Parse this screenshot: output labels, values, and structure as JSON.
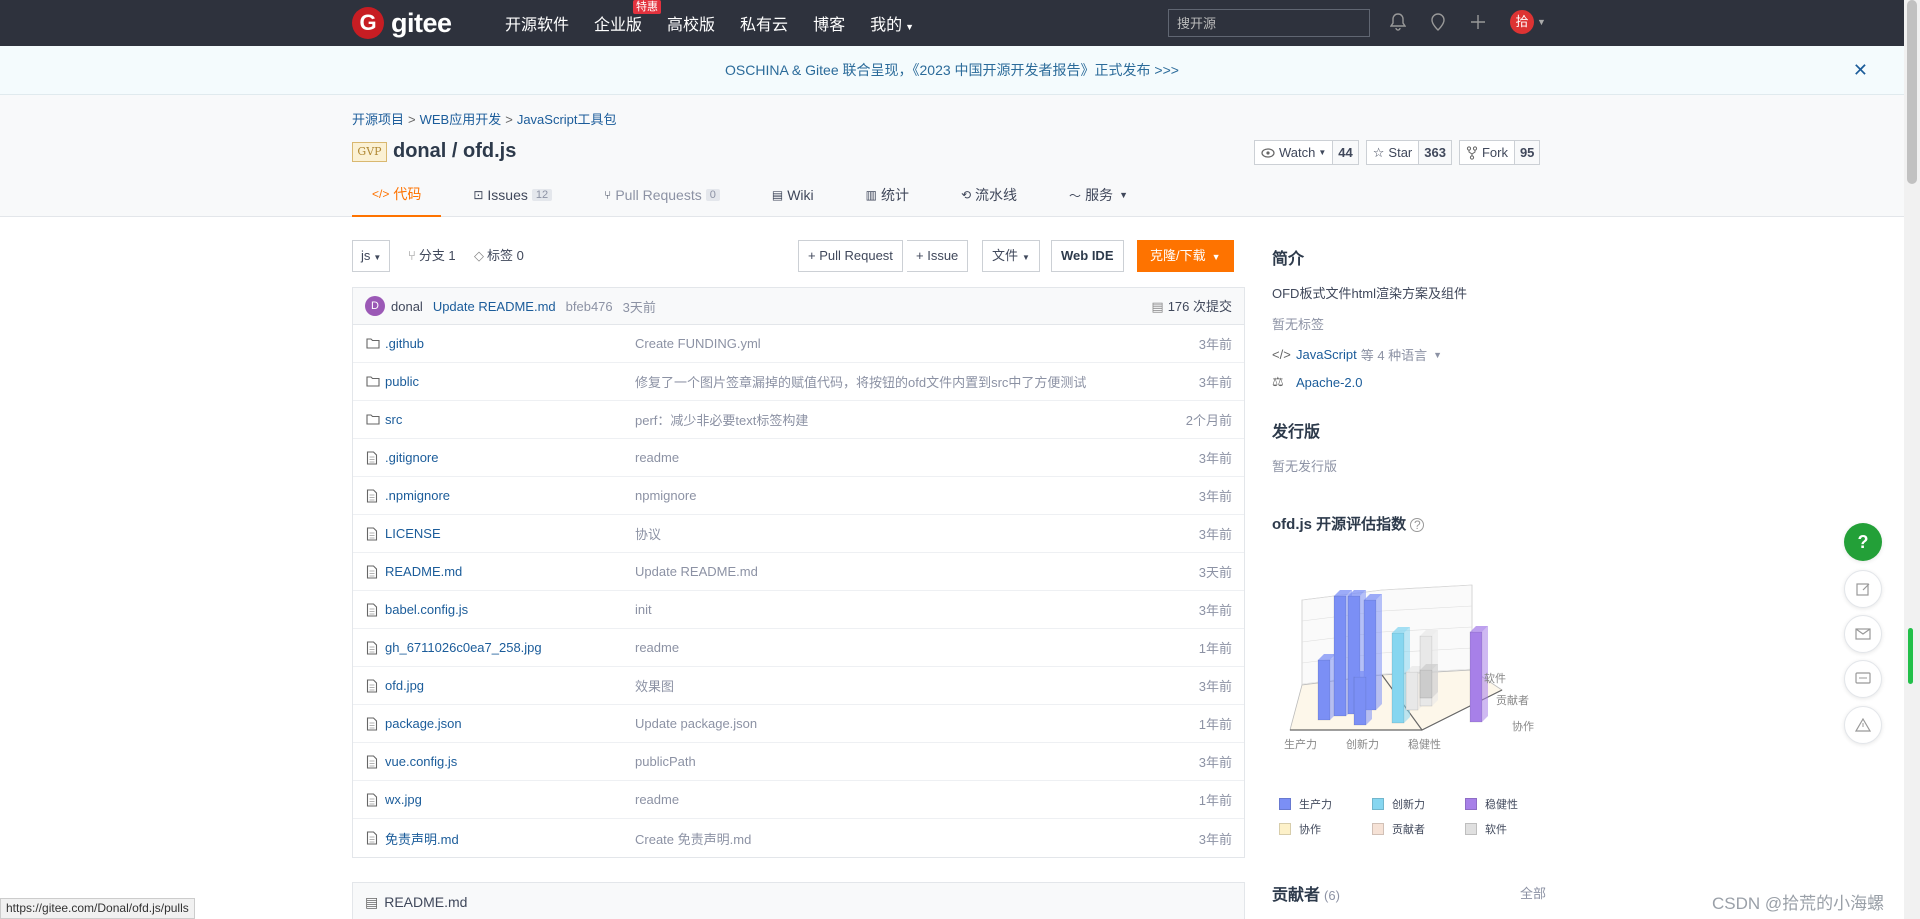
{
  "nav": {
    "logo_text": "gitee",
    "links": [
      "开源软件",
      "企业版",
      "高校版",
      "私有云",
      "博客",
      "我的"
    ],
    "hot_badge": "特惠",
    "search_placeholder": "搜开源",
    "user_avatar": "拾"
  },
  "banner": {
    "text": "OSCHINA & Gitee 联合呈现，《2023 中国开源开发者报告》正式发布 >>>"
  },
  "breadcrumb": [
    "开源项目",
    "WEB应用开发",
    "JavaScript工具包"
  ],
  "repo": {
    "badge": "GVP",
    "title": "donal / ofd.js",
    "watch_label": "Watch",
    "watch_count": "44",
    "star_label": "Star",
    "star_count": "363",
    "fork_label": "Fork",
    "fork_count": "95"
  },
  "tabs": [
    {
      "label": "代码"
    },
    {
      "label": "Issues",
      "count": "12"
    },
    {
      "label": "Pull Requests",
      "count": "0"
    },
    {
      "label": "Wiki"
    },
    {
      "label": "统计"
    },
    {
      "label": "流水线"
    },
    {
      "label": "服务"
    }
  ],
  "toolbar": {
    "branch": "js",
    "branches": "分支 1",
    "tags": "标签 0",
    "pull_request": "+ Pull Request",
    "issue": "+ Issue",
    "file": "文件",
    "webide": "Web IDE",
    "clone": "克隆/下载"
  },
  "commit": {
    "avatar": "D",
    "author": "donal",
    "message": "Update README.md",
    "hash": "bfeb476",
    "time": "3天前",
    "total": "176 次提交"
  },
  "files": [
    {
      "name": ".github",
      "type": "folder",
      "msg": "Create FUNDING.yml",
      "time": "3年前"
    },
    {
      "name": "public",
      "type": "folder",
      "msg": "修复了一个图片签章漏掉的赋值代码，将按钮的ofd文件内置到src中了方便测试",
      "time": "3年前"
    },
    {
      "name": "src",
      "type": "folder",
      "msg": "perf：减少非必要text标签构建",
      "time": "2个月前"
    },
    {
      "name": ".gitignore",
      "type": "file",
      "msg": "readme",
      "time": "3年前"
    },
    {
      "name": ".npmignore",
      "type": "file",
      "msg": "npmignore",
      "time": "3年前"
    },
    {
      "name": "LICENSE",
      "type": "file",
      "msg": "协议",
      "time": "3年前"
    },
    {
      "name": "README.md",
      "type": "file",
      "msg": "Update README.md",
      "time": "3天前"
    },
    {
      "name": "babel.config.js",
      "type": "file",
      "msg": "init",
      "time": "3年前"
    },
    {
      "name": "gh_6711026c0ea7_258.jpg",
      "type": "file",
      "msg": "readme",
      "time": "1年前"
    },
    {
      "name": "ofd.jpg",
      "type": "file",
      "msg": "效果图",
      "time": "3年前"
    },
    {
      "name": "package.json",
      "type": "file",
      "msg": "Update package.json",
      "time": "1年前"
    },
    {
      "name": "vue.config.js",
      "type": "file",
      "msg": "publicPath",
      "time": "3年前"
    },
    {
      "name": "wx.jpg",
      "type": "file",
      "msg": "readme",
      "time": "1年前"
    },
    {
      "name": "免责声明.md",
      "type": "file",
      "msg": "Create 免责声明.md",
      "time": "3年前"
    }
  ],
  "readme": {
    "title": "README.md"
  },
  "sidebar": {
    "intro_title": "简介",
    "intro_text": "OFD板式文件html渲染方案及组件",
    "no_tags": "暂无标签",
    "language": "JavaScript",
    "language_more": "等 4 种语言",
    "license": "Apache-2.0",
    "release_title": "发行版",
    "no_release": "暂无发行版",
    "index_title": "ofd.js 开源评估指数",
    "contrib_title": "贡献者",
    "contrib_count": "(6)",
    "contrib_all": "全部"
  },
  "chart_data": {
    "type": "bar",
    "x_axis_labels": [
      "生产力",
      "创新力",
      "稳健性"
    ],
    "depth_axis_labels": [
      "软件",
      "贡献者",
      "协作"
    ],
    "legend": [
      {
        "name": "生产力",
        "color": "#7b8ff5"
      },
      {
        "name": "创新力",
        "color": "#86d6f0"
      },
      {
        "name": "稳健性",
        "color": "#a780e8"
      },
      {
        "name": "协作",
        "color": "#fdf1c9"
      },
      {
        "name": "贡献者",
        "color": "#f6e2d6"
      },
      {
        "name": "软件",
        "color": "#e0e0e0"
      }
    ]
  },
  "footer": {
    "status_url": "https://gitee.com/Donal/ofd.js/pulls",
    "watermark": "CSDN @拾荒的小海螺"
  },
  "colors": {
    "accent": "#fe7300",
    "nav_bg": "#2e323d",
    "link": "#1b5c9a",
    "help_green": "#23a038"
  }
}
